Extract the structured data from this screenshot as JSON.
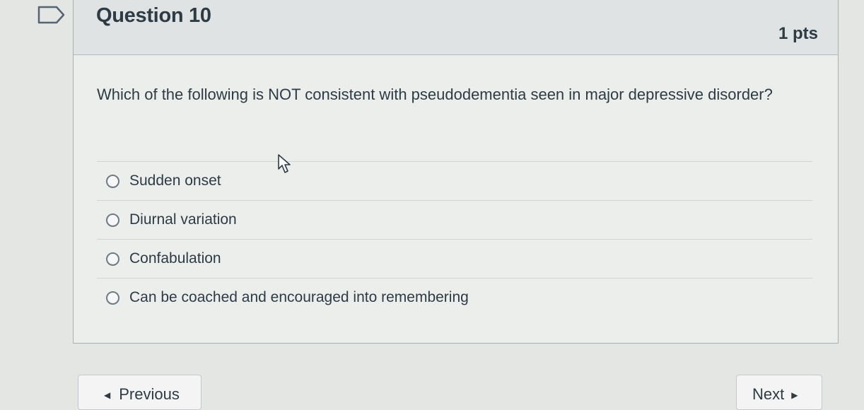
{
  "question": {
    "title": "Question 10",
    "points": "1 pts",
    "text": "Which of the following is NOT consistent with pseudodementia seen in major depressive disorder?"
  },
  "answers": [
    {
      "label": "Sudden onset",
      "selected": false
    },
    {
      "label": "Diurnal variation",
      "selected": false
    },
    {
      "label": "Confabulation",
      "selected": false
    },
    {
      "label": "Can be coached and encouraged into remembering",
      "selected": false
    }
  ],
  "navigation": {
    "previous_label": "Previous",
    "next_label": "Next"
  },
  "icons": {
    "flag": "flag-icon",
    "cursor": "mouse-cursor-icon",
    "previous_arrow": "triangle-left-icon",
    "next_arrow": "triangle-right-icon"
  },
  "colors": {
    "text": "#2d3b45",
    "header_background": "#dfe3e4",
    "panel_background": "#eceeec",
    "page_background": "#e4e6e4"
  }
}
